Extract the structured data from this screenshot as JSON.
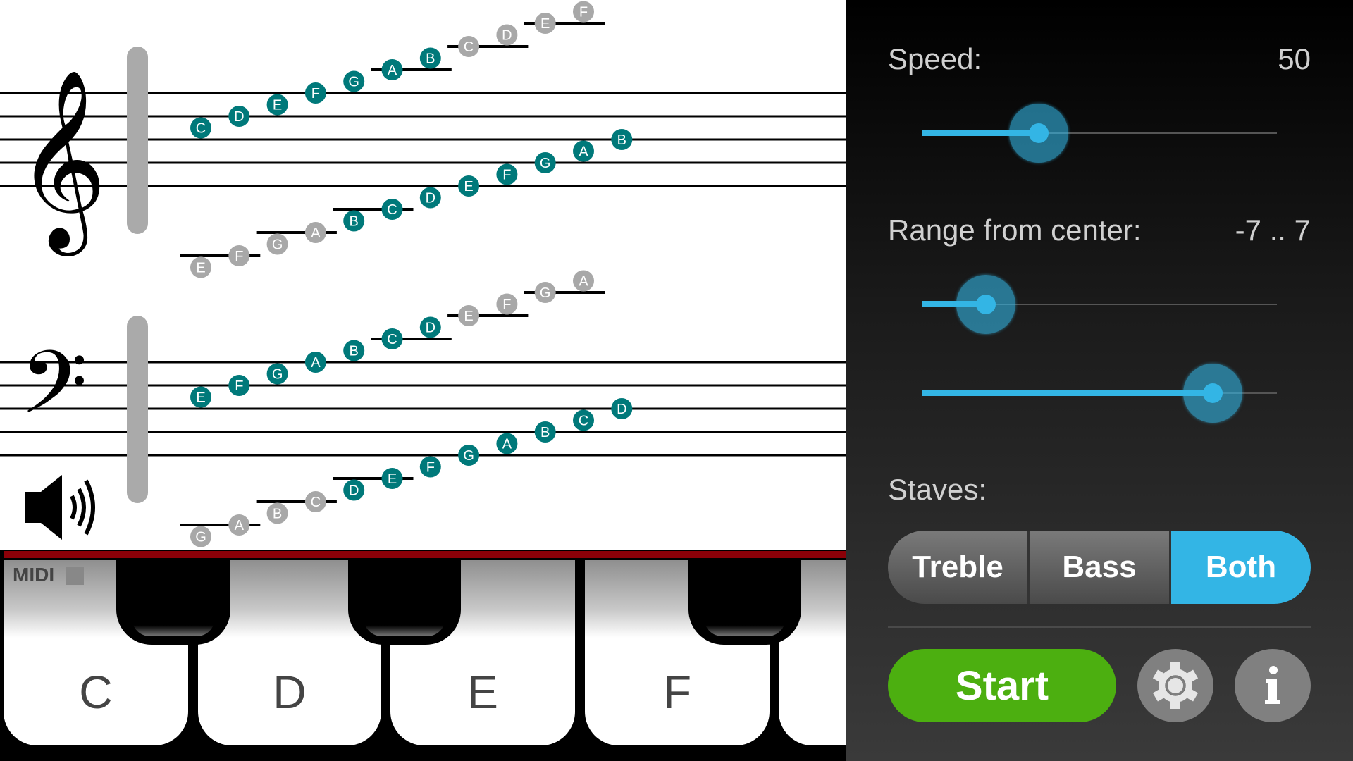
{
  "staff": {
    "clefs": [
      "treble-clef",
      "bass-clef"
    ],
    "treble": {
      "upper_run": [
        {
          "note": "C",
          "state": "active"
        },
        {
          "note": "D",
          "state": "active"
        },
        {
          "note": "E",
          "state": "active"
        },
        {
          "note": "F",
          "state": "active"
        },
        {
          "note": "G",
          "state": "active"
        },
        {
          "note": "A",
          "state": "active"
        },
        {
          "note": "B",
          "state": "active"
        },
        {
          "note": "C",
          "state": "inactive"
        },
        {
          "note": "D",
          "state": "inactive"
        },
        {
          "note": "E",
          "state": "inactive"
        },
        {
          "note": "F",
          "state": "inactive"
        }
      ],
      "lower_run": [
        {
          "note": "E",
          "state": "inactive"
        },
        {
          "note": "F",
          "state": "inactive"
        },
        {
          "note": "G",
          "state": "inactive"
        },
        {
          "note": "A",
          "state": "inactive"
        },
        {
          "note": "B",
          "state": "active"
        },
        {
          "note": "C",
          "state": "active"
        },
        {
          "note": "D",
          "state": "active"
        },
        {
          "note": "E",
          "state": "active"
        },
        {
          "note": "F",
          "state": "active"
        },
        {
          "note": "G",
          "state": "active"
        },
        {
          "note": "A",
          "state": "active"
        },
        {
          "note": "B",
          "state": "active"
        }
      ]
    },
    "bass": {
      "upper_run": [
        {
          "note": "E",
          "state": "active"
        },
        {
          "note": "F",
          "state": "active"
        },
        {
          "note": "G",
          "state": "active"
        },
        {
          "note": "A",
          "state": "active"
        },
        {
          "note": "B",
          "state": "active"
        },
        {
          "note": "C",
          "state": "active"
        },
        {
          "note": "D",
          "state": "active"
        },
        {
          "note": "E",
          "state": "inactive"
        },
        {
          "note": "F",
          "state": "inactive"
        },
        {
          "note": "G",
          "state": "inactive"
        },
        {
          "note": "A",
          "state": "inactive"
        }
      ],
      "lower_run": [
        {
          "note": "G",
          "state": "inactive"
        },
        {
          "note": "A",
          "state": "inactive"
        },
        {
          "note": "B",
          "state": "inactive"
        },
        {
          "note": "C",
          "state": "inactive"
        },
        {
          "note": "D",
          "state": "active"
        },
        {
          "note": "E",
          "state": "active"
        },
        {
          "note": "F",
          "state": "active"
        },
        {
          "note": "G",
          "state": "active"
        },
        {
          "note": "A",
          "state": "active"
        },
        {
          "note": "B",
          "state": "active"
        },
        {
          "note": "C",
          "state": "active"
        },
        {
          "note": "D",
          "state": "active"
        }
      ]
    },
    "colors": {
      "active": "#00797a",
      "inactive": "#a8a8a8"
    },
    "sound_icon": "speaker-icon"
  },
  "piano": {
    "midi_label": "MIDI",
    "white_keys": [
      "C",
      "D",
      "E",
      "F",
      ""
    ],
    "accent_bar_color": "#8b0008"
  },
  "settings": {
    "speed": {
      "label": "Speed:",
      "value": "50",
      "fraction": 0.33
    },
    "range": {
      "label": "Range from center:",
      "value": "-7 .. 7",
      "low_fraction": 0.18,
      "high_fraction": 0.82
    },
    "staves": {
      "label": "Staves:",
      "options": [
        "Treble",
        "Bass",
        "Both"
      ],
      "selected": "Both"
    },
    "start_label": "Start",
    "settings_icon": "gear-icon",
    "info_icon": "info-icon",
    "accent_color": "#33b5e5",
    "start_color": "#4caf10"
  }
}
